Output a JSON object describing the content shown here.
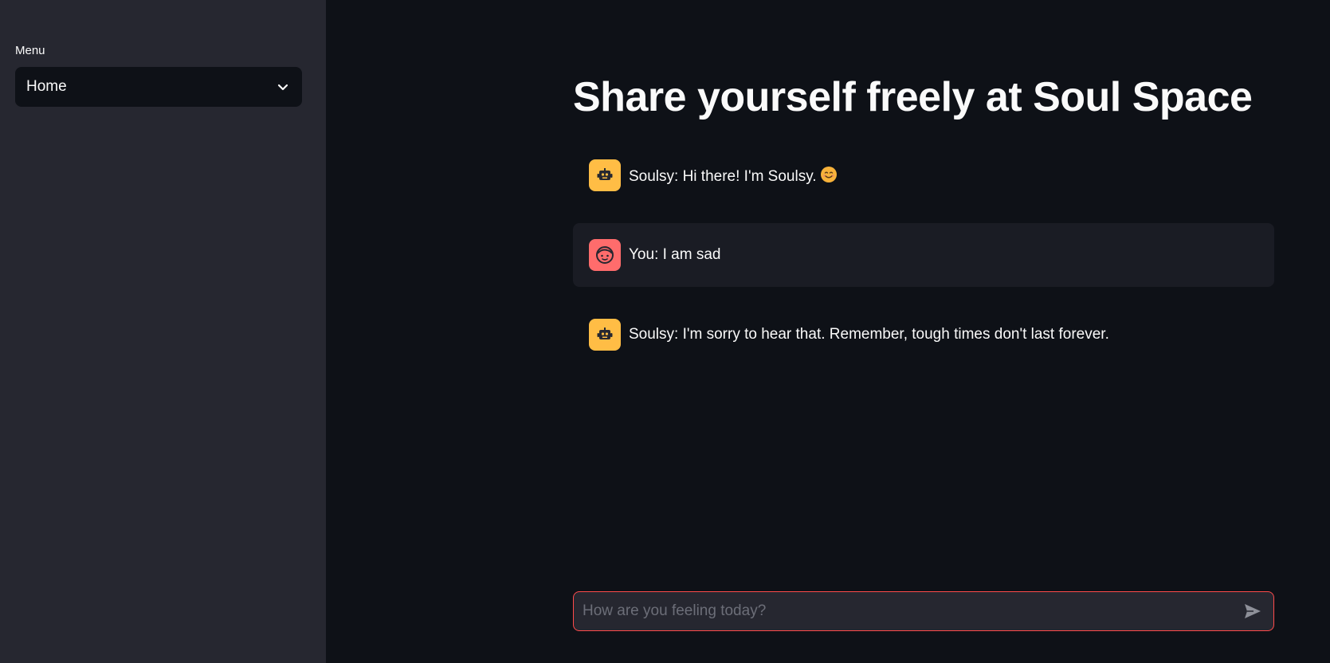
{
  "sidebar": {
    "menu_label": "Menu",
    "selected": "Home"
  },
  "main": {
    "title": "Share yourself freely at Soul Space",
    "messages": [
      {
        "role": "assistant",
        "avatar_icon": "robot-icon",
        "text": "Soulsy: Hi there! I'm Soulsy.",
        "emoji": "smiling-face-icon"
      },
      {
        "role": "user",
        "avatar_icon": "user-face-icon",
        "text": "You: I am sad"
      },
      {
        "role": "assistant",
        "avatar_icon": "robot-icon",
        "text": "Soulsy: I'm sorry to hear that. Remember, tough times don't last forever."
      }
    ],
    "chat_input": {
      "placeholder": "How are you feeling today?",
      "value": ""
    }
  },
  "colors": {
    "background": "#0e1117",
    "sidebar": "#262730",
    "bot_avatar": "#ffbd45",
    "user_avatar": "#ff6c6c",
    "input_border": "#ff4b4b"
  }
}
